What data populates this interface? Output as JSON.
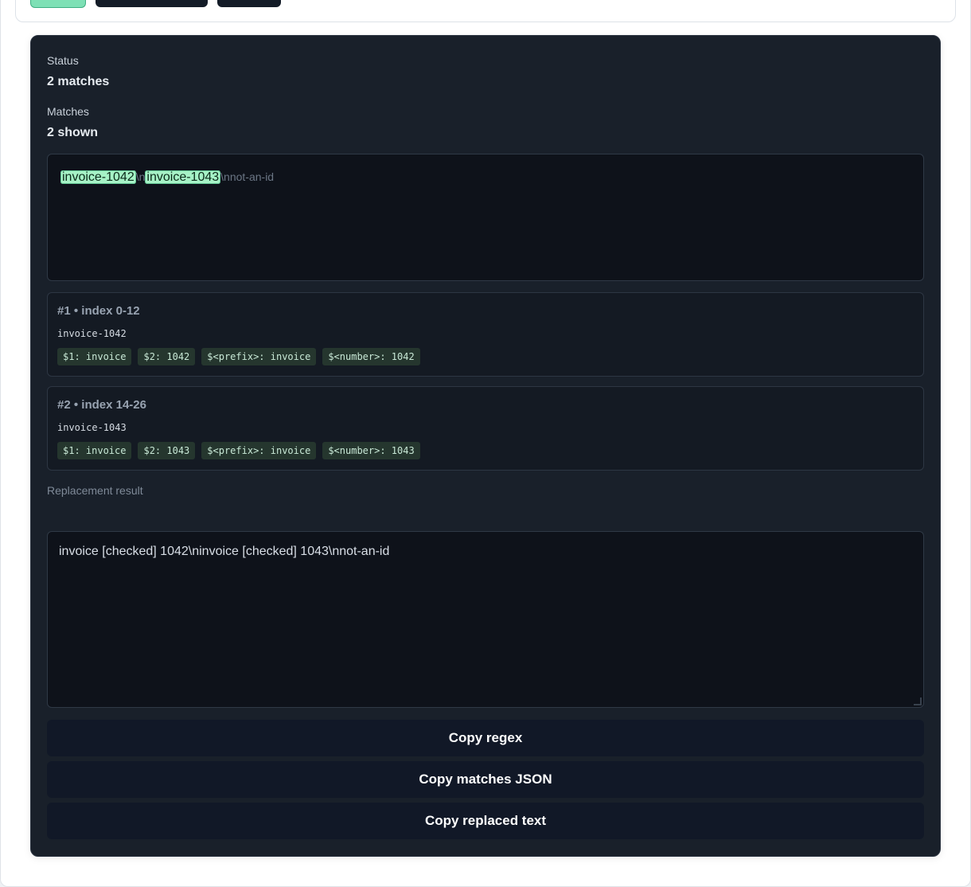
{
  "status": {
    "label": "Status",
    "value": "2 matches"
  },
  "matches_summary": {
    "label": "Matches",
    "value": "2 shown"
  },
  "highlight": {
    "match1": "invoice-1042",
    "sep1": "\\n",
    "match2": "invoice-1043",
    "rest": "\\nnot-an-id"
  },
  "matches": [
    {
      "num": "#1",
      "index": "index 0-12",
      "text": "invoice-1042",
      "groups": [
        "$1: invoice",
        "$2: 1042",
        "$<prefix>: invoice",
        "$<number>: 1042"
      ]
    },
    {
      "num": "#2",
      "index": "index 14-26",
      "text": "invoice-1043",
      "groups": [
        "$1: invoice",
        "$2: 1043",
        "$<prefix>: invoice",
        "$<number>: 1043"
      ]
    }
  ],
  "replacement": {
    "label": "Replacement result",
    "value": "invoice [checked] 1042\\ninvoice [checked] 1043\\nnot-an-id"
  },
  "buttons": {
    "copy_regex": "Copy regex",
    "copy_matches_json": "Copy matches JSON",
    "copy_replaced_text": "Copy replaced text"
  },
  "colors": {
    "panel_bg": "#19202a",
    "highlight": "#a6f2c6",
    "accent_button": "#7ee0b5"
  }
}
